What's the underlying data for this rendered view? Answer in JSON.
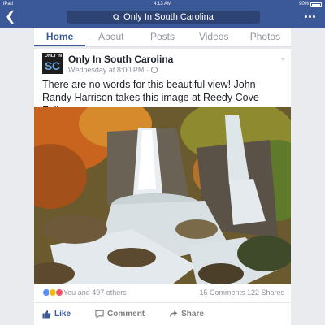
{
  "status": {
    "device": "iPad",
    "time": "4:13 AM",
    "battery": "90%"
  },
  "nav": {
    "back_icon": "chevron-left-icon",
    "search_text": "Only In South Carolina"
  },
  "tabs": [
    {
      "label": "Home",
      "active": true
    },
    {
      "label": "About",
      "active": false
    },
    {
      "label": "Posts",
      "active": false
    },
    {
      "label": "Videos",
      "active": false
    },
    {
      "label": "Photos",
      "active": false
    }
  ],
  "post": {
    "avatar_text_top": "ONLY IN",
    "avatar_text_main": "SC",
    "page_name": "Only In South Carolina",
    "time": "Wednesday at 8:00 PM ·",
    "text": "There are no words for this beautiful view! John Randy Harrison takes this image at Reedy Cove Falls.",
    "reactions_text": "You and 497 others",
    "comments_shares": "15 Comments  122 Shares"
  },
  "actions": {
    "like": "Like",
    "comment": "Comment",
    "share": "Share"
  },
  "colors": {
    "brand": "#3b5998",
    "like": "#3b5998"
  }
}
